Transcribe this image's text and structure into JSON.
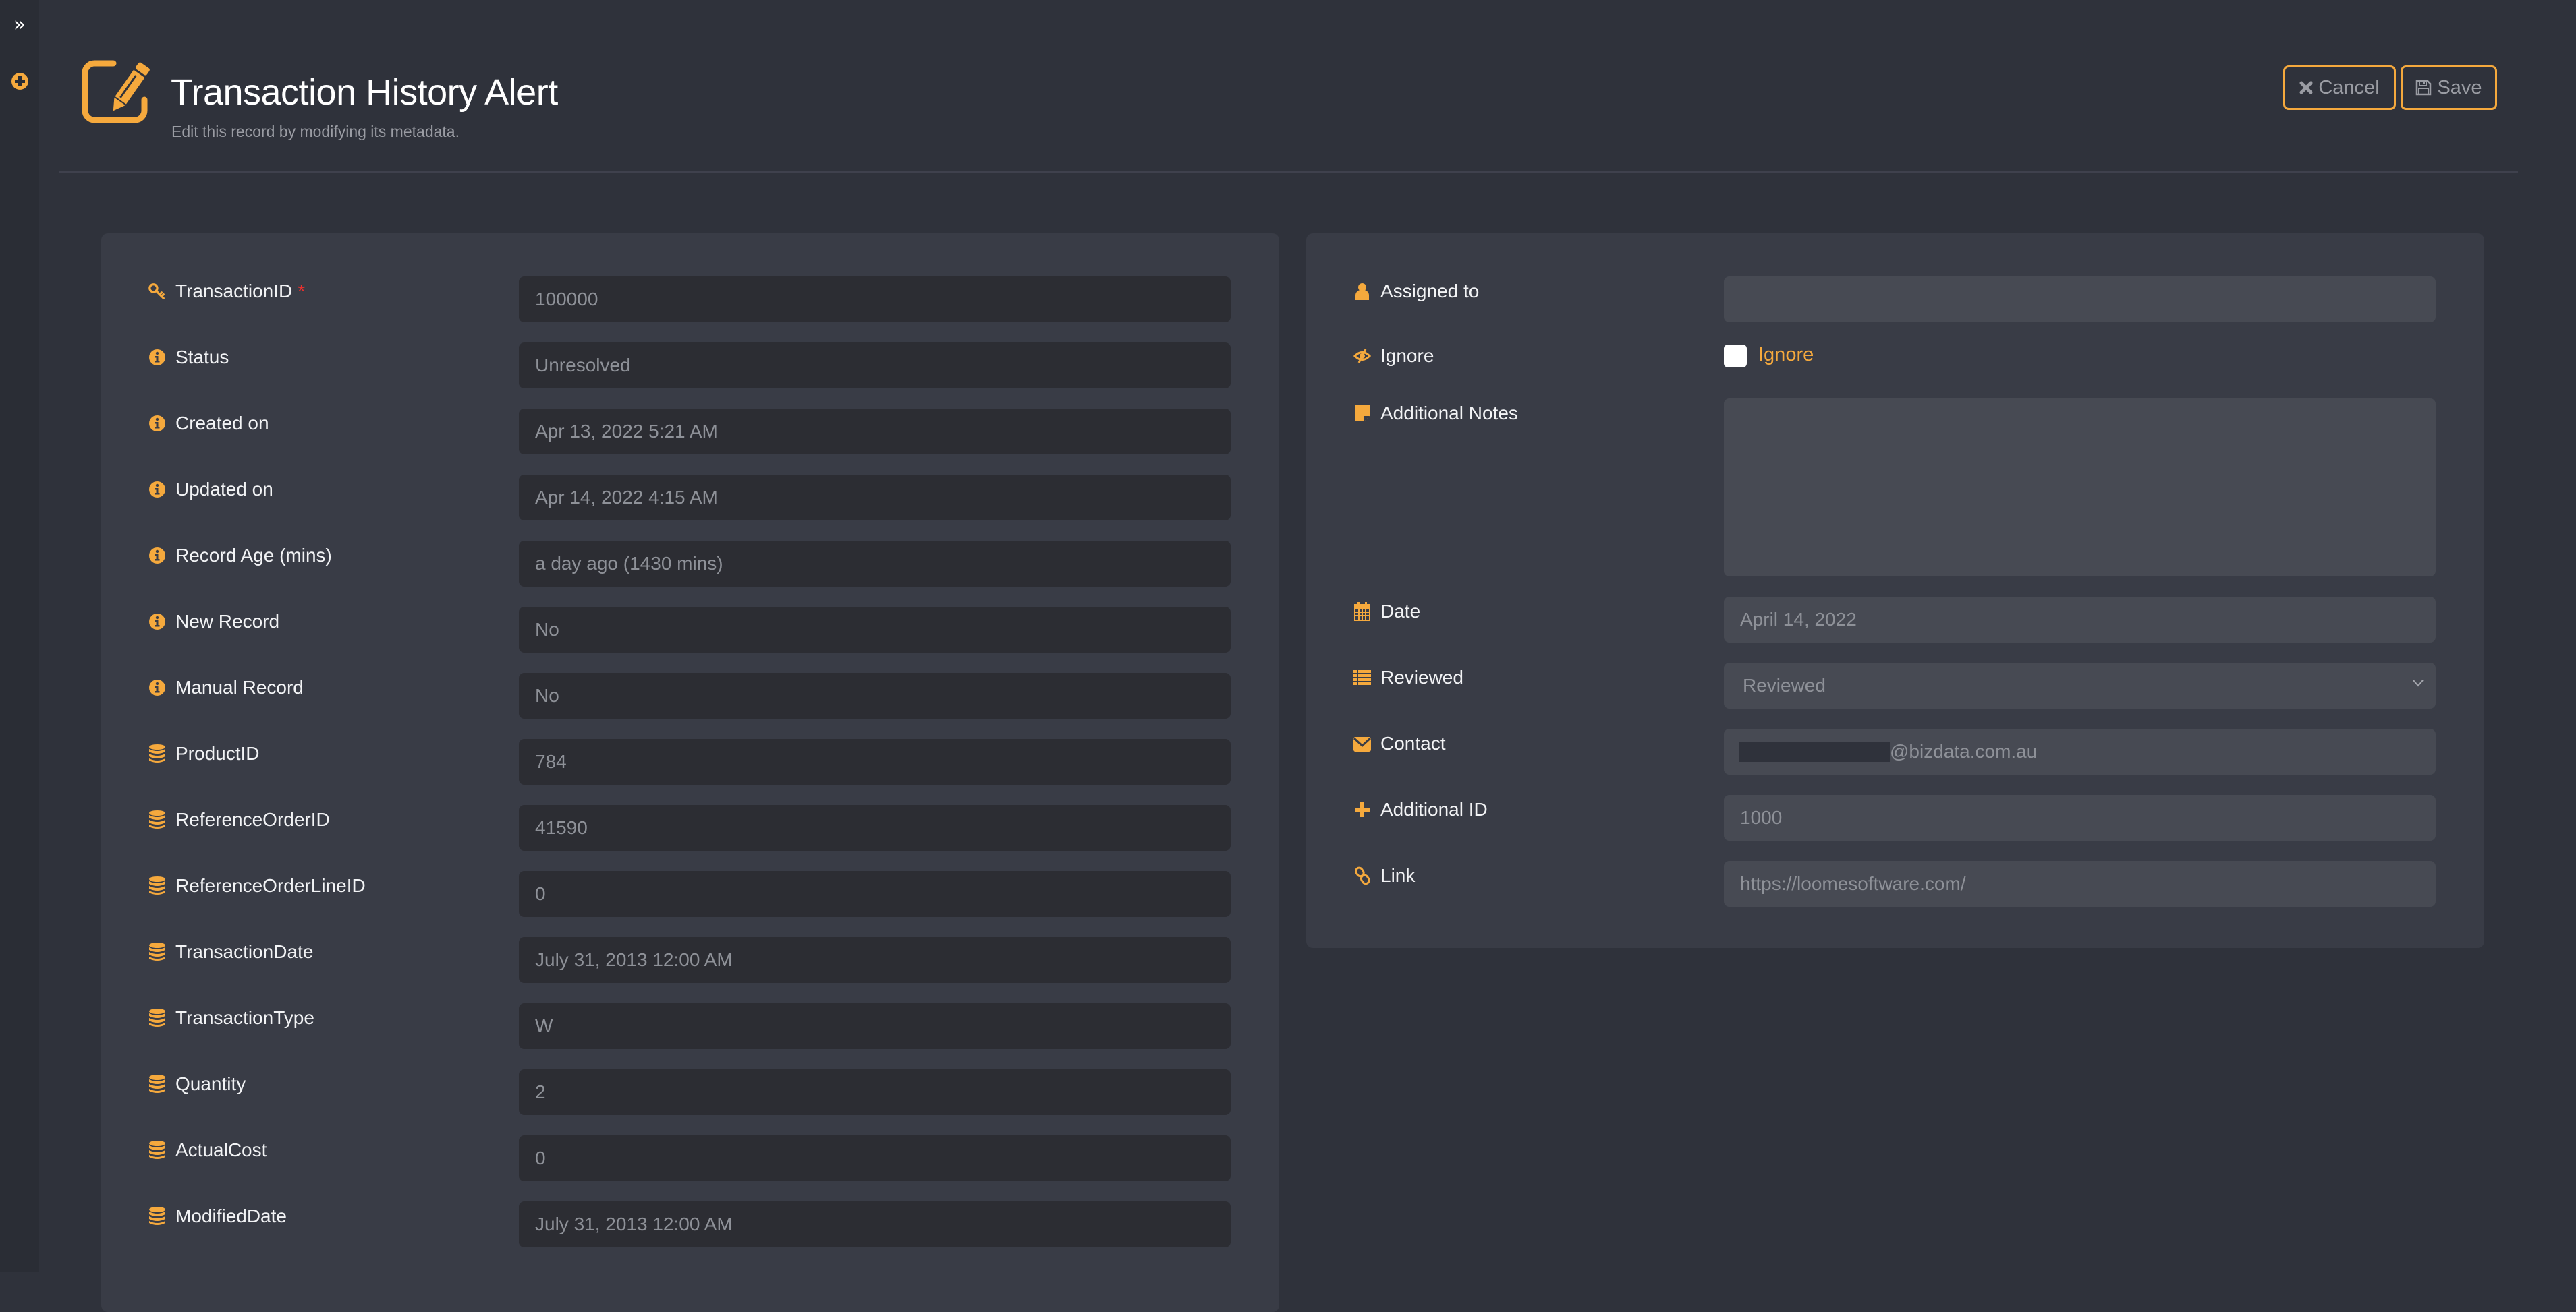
{
  "sidebar": {
    "expand_icon": "double-chevron-right-icon",
    "expand_glyph": "»",
    "add_icon": "plus-circle-icon"
  },
  "header": {
    "icon": "edit-square-icon",
    "title": "Transaction History Alert",
    "subtitle": "Edit this record by modifying its metadata.",
    "cancel_label": "Cancel",
    "save_label": "Save"
  },
  "colors": {
    "accent": "#f5a93d",
    "background": "#2f323b",
    "panel": "#393c46",
    "required": "#e8302e"
  },
  "left_fields": [
    {
      "label": "TransactionID",
      "icon": "key-icon",
      "required": true,
      "value": "100000"
    },
    {
      "label": "Status",
      "icon": "info-circle-icon",
      "value": "Unresolved"
    },
    {
      "label": "Created on",
      "icon": "info-circle-icon",
      "value": "Apr 13, 2022 5:21 AM"
    },
    {
      "label": "Updated on",
      "icon": "info-circle-icon",
      "value": "Apr 14, 2022 4:15 AM"
    },
    {
      "label": "Record Age (mins)",
      "icon": "info-circle-icon",
      "value": "a day ago (1430 mins)"
    },
    {
      "label": "New Record",
      "icon": "info-circle-icon",
      "value": "No"
    },
    {
      "label": "Manual Record",
      "icon": "info-circle-icon",
      "value": "No"
    },
    {
      "label": "ProductID",
      "icon": "database-icon",
      "value": "784"
    },
    {
      "label": "ReferenceOrderID",
      "icon": "database-icon",
      "value": "41590"
    },
    {
      "label": "ReferenceOrderLineID",
      "icon": "database-icon",
      "value": "0"
    },
    {
      "label": "TransactionDate",
      "icon": "database-icon",
      "value": "July 31, 2013 12:00 AM"
    },
    {
      "label": "TransactionType",
      "icon": "database-icon",
      "value": "W"
    },
    {
      "label": "Quantity",
      "icon": "database-icon",
      "value": "2"
    },
    {
      "label": "ActualCost",
      "icon": "database-icon",
      "value": "0"
    },
    {
      "label": "ModifiedDate",
      "icon": "database-icon",
      "value": "July 31, 2013 12:00 AM"
    }
  ],
  "right_fields": {
    "assigned_to": {
      "label": "Assigned to",
      "icon": "user-icon",
      "value": ""
    },
    "ignore": {
      "label": "Ignore",
      "icon": "eye-slash-icon",
      "checkbox_label": "Ignore",
      "checked": false
    },
    "notes": {
      "label": "Additional Notes",
      "icon": "sticky-note-icon",
      "value": ""
    },
    "date": {
      "label": "Date",
      "icon": "calendar-icon",
      "value": "April 14, 2022"
    },
    "reviewed": {
      "label": "Reviewed",
      "icon": "list-icon",
      "value": "Reviewed"
    },
    "contact": {
      "label": "Contact",
      "icon": "envelope-icon",
      "value_suffix": "@bizdata.com.au",
      "redacted": true
    },
    "additional_id": {
      "label": "Additional ID",
      "icon": "plus-icon",
      "value": "1000"
    },
    "link": {
      "label": "Link",
      "icon": "link-icon",
      "value": "https://loomesoftware.com/"
    }
  }
}
